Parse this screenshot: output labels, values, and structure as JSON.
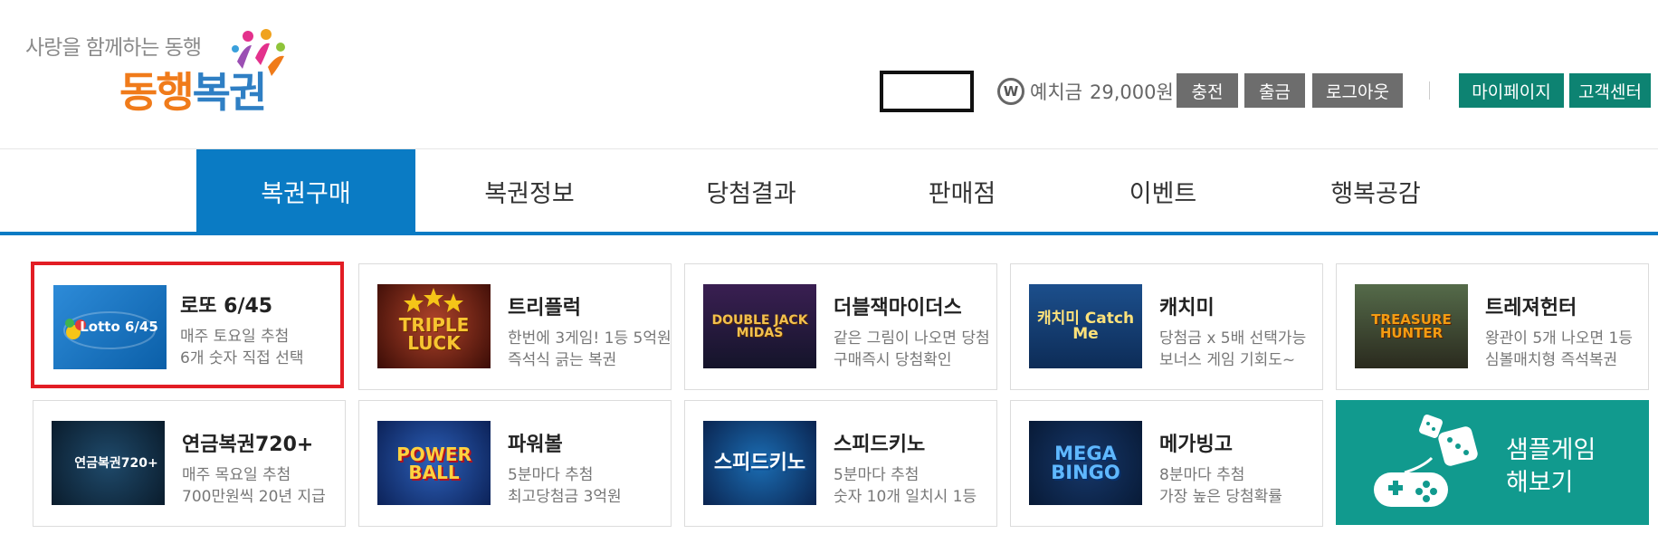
{
  "logo": {
    "slogan": "사랑을 함께하는 동행",
    "name_part1": "동행",
    "name_part2": "복권"
  },
  "account": {
    "deposit_label": "예치금",
    "deposit_amount": "29,000원",
    "won_symbol": "W"
  },
  "buttons": {
    "charge": "충전",
    "withdraw": "출금",
    "logout": "로그아웃",
    "mypage": "마이페이지",
    "support": "고객센터"
  },
  "nav": {
    "items": [
      {
        "label": "복권구매",
        "active": true
      },
      {
        "label": "복권정보",
        "active": false
      },
      {
        "label": "당첨결과",
        "active": false
      },
      {
        "label": "판매점",
        "active": false
      },
      {
        "label": "이벤트",
        "active": false
      },
      {
        "label": "행복공감",
        "active": false
      }
    ]
  },
  "games": [
    {
      "title": "로또 6/45",
      "desc1": "매주 토요일 추첨",
      "desc2": "6개 숫자 직접 선택",
      "thumb_text": "Lotto 6/45",
      "thumb_icon": "lotto-logo-icon",
      "selected": true
    },
    {
      "title": "트리플럭",
      "desc1": "한번에 3게임! 1등 5억원",
      "desc2": "즉석식 긁는 복권",
      "thumb_text": "TRIPLE LUCK",
      "thumb_icon": "triple-luck-logo-icon",
      "selected": false
    },
    {
      "title": "더블잭마이더스",
      "desc1": "같은 그림이 나오면 당첨",
      "desc2": "구매즉시 당첨확인",
      "thumb_text": "DOUBLE JACK MIDAS",
      "thumb_icon": "double-jack-midas-logo-icon",
      "selected": false
    },
    {
      "title": "캐치미",
      "desc1": "당첨금 x 5배 선택가능",
      "desc2": "보너스 게임 기회도~",
      "thumb_text": "캐치미 Catch Me",
      "thumb_icon": "catch-me-logo-icon",
      "selected": false
    },
    {
      "title": "트레져헌터",
      "desc1": "왕관이 5개 나오면 1등",
      "desc2": "심볼매치형 즉석복권",
      "thumb_text": "TREASURE HUNTER",
      "thumb_icon": "treasure-hunter-logo-icon",
      "selected": false
    },
    {
      "title": "연금복권720+",
      "desc1": "매주 목요일 추첨",
      "desc2": "700만원씩 20년 지급",
      "thumb_text": "연금복권720+",
      "thumb_icon": "pension-lottery-logo-icon",
      "selected": false
    },
    {
      "title": "파워볼",
      "desc1": "5분마다 추첨",
      "desc2": "최고당첨금 3억원",
      "thumb_text": "POWER BALL",
      "thumb_icon": "power-ball-logo-icon",
      "selected": false
    },
    {
      "title": "스피드키노",
      "desc1": "5분마다 추첨",
      "desc2": "숫자 10개 일치시 1등",
      "thumb_text": "스피드키노",
      "thumb_icon": "speed-keno-logo-icon",
      "selected": false
    },
    {
      "title": "메가빙고",
      "desc1": "8분마다 추첨",
      "desc2": "가장 높은 당첨확률",
      "thumb_text": "MEGA BINGO",
      "thumb_icon": "mega-bingo-logo-icon",
      "selected": false
    }
  ],
  "sample_game": {
    "line1": "샘플게임",
    "line2": "해보기",
    "icon": "gamepad-dice-icon"
  },
  "colors": {
    "primary_blue": "#0a7bc4",
    "teal": "#0d8372",
    "sample_teal": "#119a8e",
    "gray_button": "#6d6d6d",
    "selected_border": "#e21d24",
    "logo_orange": "#f07b1a"
  }
}
